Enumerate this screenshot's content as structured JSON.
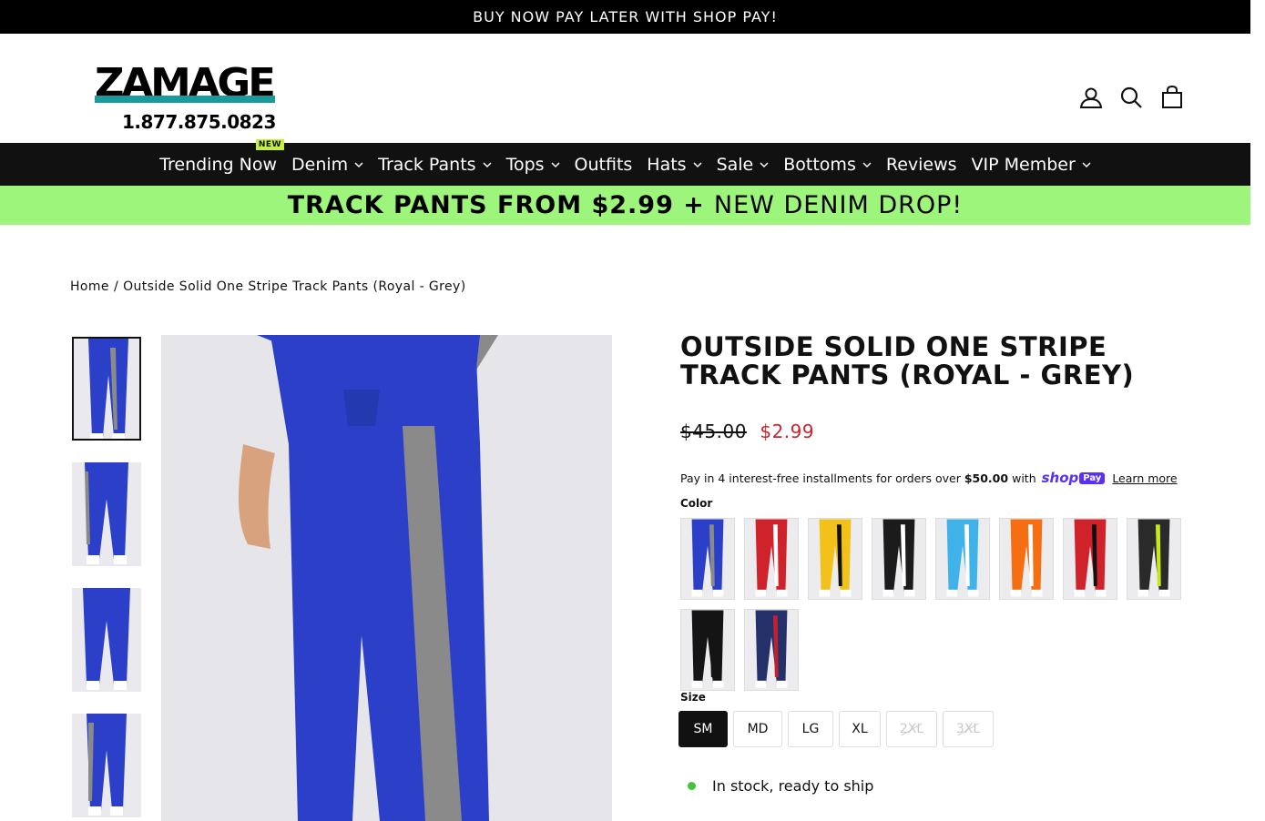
{
  "announcement": "BUY NOW PAY LATER WITH SHOP PAY!",
  "logo": {
    "wordmark": "ZAMAGE",
    "phone": "1.877.875.0823"
  },
  "header_icons": [
    "account-icon",
    "search-icon",
    "cart-icon"
  ],
  "nav": {
    "items": [
      {
        "label": "Trending Now",
        "badge": "NEW",
        "dropdown": false
      },
      {
        "label": "Denim",
        "dropdown": true
      },
      {
        "label": "Track Pants",
        "dropdown": true
      },
      {
        "label": "Tops",
        "dropdown": true
      },
      {
        "label": "Outfits",
        "dropdown": false
      },
      {
        "label": "Hats",
        "dropdown": true
      },
      {
        "label": "Sale",
        "dropdown": true
      },
      {
        "label": "Bottoms",
        "dropdown": true
      },
      {
        "label": "Reviews",
        "dropdown": false
      },
      {
        "label": "VIP Member",
        "dropdown": true
      }
    ]
  },
  "promo": {
    "bold": "TRACK PANTS FROM $2.99 +",
    "normal": "NEW DENIM DROP!"
  },
  "breadcrumb": {
    "home": "Home",
    "separator": "/",
    "current": "Outside Solid One Stripe Track Pants (Royal - Grey)"
  },
  "product": {
    "title": "OUTSIDE SOLID ONE STRIPE TRACK PANTS (ROYAL - GREY)",
    "price_compare": "$45.00",
    "price_sale": "$2.99",
    "shoppay": {
      "prefix": "Pay in 4 interest-free installments for orders over",
      "amount": "$50.00",
      "with": "with",
      "logo_shop": "shop",
      "logo_pay": "Pay",
      "learn_more": "Learn more"
    },
    "color_label": "Color",
    "colors": [
      {
        "name": "Royal - Grey",
        "pant": "#2b3fc8",
        "stripe": "#8a8a8a"
      },
      {
        "name": "Red - White",
        "pant": "#d0222a",
        "stripe": "#ffffff"
      },
      {
        "name": "Yellow - Black",
        "pant": "#f2c21b",
        "stripe": "#111111"
      },
      {
        "name": "Black - White",
        "pant": "#1b1b1b",
        "stripe": "#ffffff"
      },
      {
        "name": "Sky - White",
        "pant": "#3fb2ea",
        "stripe": "#ffffff"
      },
      {
        "name": "Orange - White",
        "pant": "#f56e12",
        "stripe": "#ffffff"
      },
      {
        "name": "Red - Black",
        "pant": "#d0222a",
        "stripe": "#111111"
      },
      {
        "name": "Black - Lime",
        "pant": "#2a2a2a",
        "stripe": "#c4e81a"
      },
      {
        "name": "Black - Black",
        "pant": "#141414",
        "stripe": "#141414"
      },
      {
        "name": "Navy - Red",
        "pant": "#23306a",
        "stripe": "#c22030"
      }
    ],
    "size_label": "Size",
    "sizes": [
      {
        "label": "SM",
        "selected": true,
        "available": true
      },
      {
        "label": "MD",
        "selected": false,
        "available": true
      },
      {
        "label": "LG",
        "selected": false,
        "available": true
      },
      {
        "label": "XL",
        "selected": false,
        "available": true
      },
      {
        "label": "2XL",
        "selected": false,
        "available": false
      },
      {
        "label": "3XL",
        "selected": false,
        "available": false
      }
    ],
    "stock": "In stock, ready to ship"
  },
  "colors": {
    "accent_sale": "#c9252c",
    "promo_bg": "#9ef57c",
    "nav_bg": "#111111",
    "badge": "#c4ef3a",
    "instock": "#3fc43a",
    "shoppay": "#5a31f4"
  }
}
